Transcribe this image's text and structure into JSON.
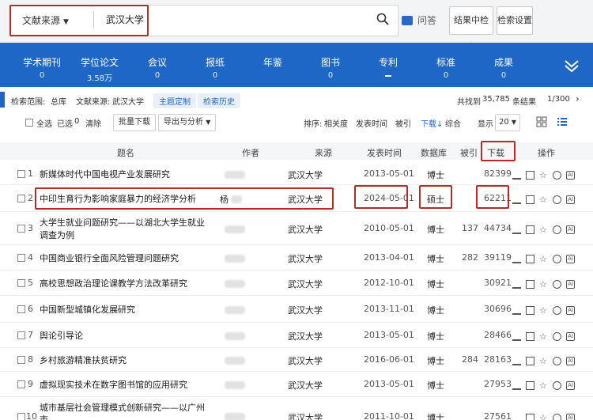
{
  "search": {
    "source_select": "文献来源",
    "query": "武汉大学",
    "qa_label": "问答",
    "buttons": [
      "结果中检索",
      "检索设置"
    ]
  },
  "nav": {
    "items": [
      {
        "label": "学术期刊",
        "count": "0"
      },
      {
        "label": "学位论文",
        "count": "3.58万"
      },
      {
        "label": "会议",
        "count": "0"
      },
      {
        "label": "报纸",
        "count": "0"
      },
      {
        "label": "年鉴",
        "count": ""
      },
      {
        "label": "图书",
        "count": "0"
      },
      {
        "label": "专利",
        "count": ""
      },
      {
        "label": "标准",
        "count": "0"
      },
      {
        "label": "成果",
        "count": "0"
      }
    ]
  },
  "info": {
    "scope_label": "检索范围:",
    "scope_value": "总库",
    "source_label": "文献来源:",
    "source_value": "武汉大学",
    "chip1": "主题定制",
    "chip2": "检索历史",
    "total_prefix": "共找到",
    "total": "35,785",
    "total_suffix": "条结果",
    "page": "1/300"
  },
  "toolbar": {
    "select_all": "全选",
    "selected": "已选",
    "selected_count": "0",
    "clear": "清除",
    "batch_download": "批量下载",
    "export": "导出与分析",
    "sort_label": "排序:",
    "sort_relevance": "相关度",
    "sort_date": "发表时间",
    "sort_cited": "被引",
    "sort_download": "下载",
    "sort_combined": "综合",
    "display_label": "显示",
    "display_count": "20"
  },
  "table": {
    "headers": {
      "title": "题名",
      "author": "作者",
      "source": "来源",
      "date": "发表时间",
      "db": "数据库",
      "cited": "被引",
      "download": "下载",
      "ops": "操作"
    },
    "rows": [
      {
        "no": "1",
        "title": [
          "新媒体时代中国电视产业发展研究"
        ],
        "author": "",
        "source": "武汉大学",
        "date": "2013-05-01",
        "db": "博士",
        "cited": "",
        "download": "82399"
      },
      {
        "no": "2",
        "title": [
          "中印生育行为影响家庭暴力的经济学分析"
        ],
        "author": "杨",
        "source": "武汉大学",
        "date": "2024-05-01",
        "db": "硕士",
        "cited": "",
        "download": "62211"
      },
      {
        "no": "3",
        "title": [
          "大学生就业问题研究——以湖北大学生就业",
          "调查为例"
        ],
        "author": "",
        "source": "武汉大学",
        "date": "2010-05-01",
        "db": "博士",
        "cited": "137",
        "download": "44734"
      },
      {
        "no": "4",
        "title": [
          "中国商业银行全面风险管理问题研究"
        ],
        "author": "",
        "source": "武汉大学",
        "date": "2013-04-01",
        "db": "博士",
        "cited": "282",
        "download": "39119"
      },
      {
        "no": "5",
        "title": [
          "高校思想政治理论课教学方法改革研究"
        ],
        "author": "",
        "source": "武汉大学",
        "date": "2012-10-01",
        "db": "博士",
        "cited": "",
        "download": "30921"
      },
      {
        "no": "6",
        "title": [
          "中国新型城镇化发展研究"
        ],
        "author": "",
        "source": "武汉大学",
        "date": "2013-11-01",
        "db": "博士",
        "cited": "",
        "download": "30696"
      },
      {
        "no": "7",
        "title": [
          "舆论引导论"
        ],
        "author": "",
        "source": "武汉大学",
        "date": "2013-05-01",
        "db": "博士",
        "cited": "",
        "download": "28466"
      },
      {
        "no": "8",
        "title": [
          "乡村旅游精准扶贫研究"
        ],
        "author": "",
        "source": "武汉大学",
        "date": "2016-06-01",
        "db": "博士",
        "cited": "284",
        "download": "28163"
      },
      {
        "no": "9",
        "title": [
          "虚拟现实技术在数字图书馆的应用研究"
        ],
        "author": "",
        "source": "武汉大学",
        "date": "2013-05-01",
        "db": "博士",
        "cited": "",
        "download": "27953"
      },
      {
        "no": "10",
        "title": [
          "城市基层社会管理模式创新研究——以广州",
          "市..."
        ],
        "author": "",
        "source": "武汉大学",
        "date": "2011-10-01",
        "db": "博士",
        "cited": "",
        "download": "27561"
      }
    ]
  }
}
